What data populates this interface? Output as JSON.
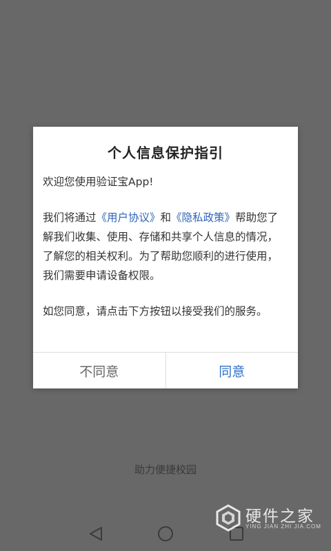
{
  "dialog": {
    "title": "个人信息保护指引",
    "welcome": "欢迎您使用验证宝App!",
    "p1_prefix": "我们将通过",
    "user_agreement_link": "《用户协议》",
    "p1_and": "和",
    "privacy_policy_link": "《隐私政策》",
    "p1_suffix": "帮助您了解我们收集、使用、存储和共享个人信息的情况，了解您的相关权利。为了帮助您顺利的进行使用，我们需要申请设备权限。",
    "p2": "如您同意，请点击下方按钮以接受我们的服务。",
    "disagree_label": "不同意",
    "agree_label": "同意"
  },
  "footer": {
    "tagline": "助力便捷校园"
  },
  "navbar": {
    "back_icon": "back-triangle-icon",
    "home_icon": "home-circle-icon",
    "recent_icon": "recent-square-icon"
  },
  "watermark": {
    "brand": "硬件之家",
    "sub": "YING JIAN ZHI JIA.COM"
  },
  "colors": {
    "overlay": "#686868",
    "link": "#2f64b8",
    "agree": "#2f6fc8",
    "disagree": "#666666"
  }
}
